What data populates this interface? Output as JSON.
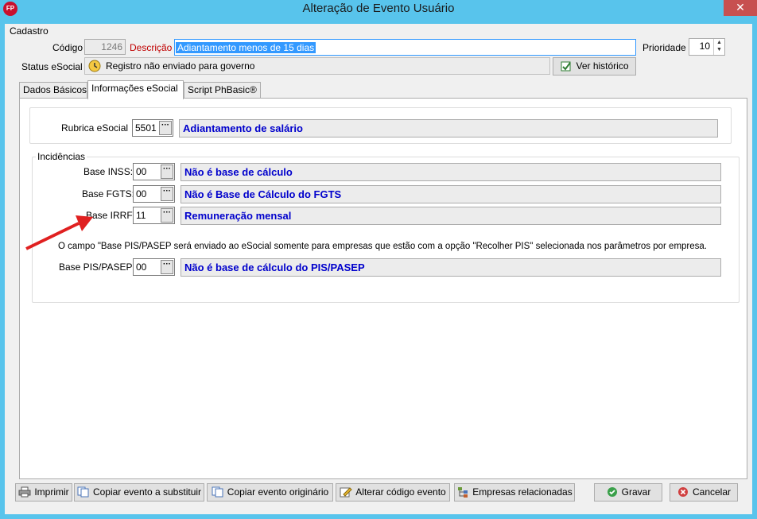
{
  "window": {
    "title": "Alteração de Evento Usuário",
    "app_icon_text": "FP",
    "close_symbol": "✕"
  },
  "cadastro": {
    "group_label": "Cadastro",
    "codigo_label": "Código",
    "codigo_value": "1246",
    "descricao_label": "Descrição",
    "descricao_value": "Adiantamento menos de 15 dias",
    "prioridade_label": "Prioridade",
    "prioridade_value": "10",
    "status_label": "Status eSocial",
    "status_value": "Registro não enviado para governo",
    "ver_historico_label": "Ver histórico"
  },
  "tabs": [
    {
      "label": "Dados Básicos"
    },
    {
      "label": "Informações eSocial",
      "active": true
    },
    {
      "label": "Script PhBasic®"
    }
  ],
  "esocial": {
    "rubrica_label": "Rubrica eSocial",
    "rubrica_code": "5501",
    "rubrica_desc": "Adiantamento de salário",
    "incidencias_label": "Incidências",
    "inss_label": "Base INSS:",
    "inss_code": "00",
    "inss_desc": "Não é base de cálculo",
    "fgts_label": "Base FGTS:",
    "fgts_code": "00",
    "fgts_desc": "Não é Base de Cálculo do FGTS",
    "irrf_label": "Base IRRF:",
    "irrf_code": "11",
    "irrf_desc": "Remuneração mensal",
    "pis_note": "O campo \"Base PIS/PASEP será enviado ao eSocial somente para empresas que estão com a opção \"Recolher PIS\" selecionada nos parâmetros por empresa.",
    "pis_label": "Base PIS/PASEP:",
    "pis_code": "00",
    "pis_desc": "Não é base de cálculo do PIS/PASEP",
    "dots": "···"
  },
  "buttons": {
    "imprimir": "Imprimir",
    "copiar_substituir": "Copiar evento a substituir",
    "copiar_originario": "Copiar evento originário",
    "alterar_codigo": "Alterar código evento",
    "empresas": "Empresas relacionadas",
    "gravar": "Gravar",
    "cancelar": "Cancelar"
  },
  "colors": {
    "accent_title": "#58c4ec",
    "link_blue": "#0000cc",
    "required_red": "#c00000",
    "arrow_red": "#e02020"
  }
}
